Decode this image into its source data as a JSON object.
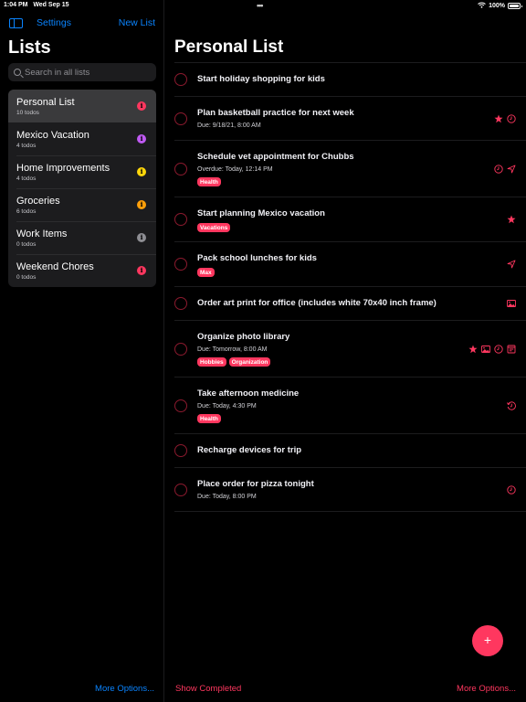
{
  "status_bar": {
    "time": "1:04 PM",
    "date": "Wed Sep 15",
    "multitask_dots": "•••",
    "battery": "100%",
    "battery_level": 1.0
  },
  "sidebar": {
    "settings_label": "Settings",
    "new_list_label": "New List",
    "title": "Lists",
    "search_placeholder": "Search in all lists",
    "lists": [
      {
        "name": "Personal List",
        "count": "10 todos",
        "color": "#ff375f",
        "selected": true
      },
      {
        "name": "Mexico Vacation",
        "count": "4 todos",
        "color": "#bf5af2",
        "selected": false
      },
      {
        "name": "Home Improvements",
        "count": "4 todos",
        "color": "#ffd60a",
        "selected": false
      },
      {
        "name": "Groceries",
        "count": "6 todos",
        "color": "#ff9f0a",
        "selected": false
      },
      {
        "name": "Work Items",
        "count": "0 todos",
        "color": "#8e8e93",
        "selected": false
      },
      {
        "name": "Weekend Chores",
        "count": "0 todos",
        "color": "#ff375f",
        "selected": false
      }
    ],
    "info_glyph": "i",
    "more_options_label": "More Options..."
  },
  "main": {
    "title": "Personal List",
    "accent": "#ff375f",
    "todos": [
      {
        "title": "Start holiday shopping for kids",
        "due": "",
        "tags": [],
        "icons": []
      },
      {
        "title": "Plan basketball practice for next week",
        "due": "Due: 9/18/21, 8:00 AM",
        "tags": [],
        "icons": [
          "star-icon",
          "clock-icon"
        ]
      },
      {
        "title": "Schedule vet appointment for Chubbs",
        "due": "Overdue: Today, 12:14 PM",
        "tags": [
          "Health"
        ],
        "icons": [
          "clock-icon",
          "location-icon"
        ]
      },
      {
        "title": "Start planning Mexico vacation",
        "due": "",
        "tags": [
          "Vacations"
        ],
        "icons": [
          "star-icon"
        ]
      },
      {
        "title": "Pack school lunches for kids",
        "due": "",
        "tags": [
          "Max"
        ],
        "icons": [
          "location-icon"
        ]
      },
      {
        "title": "Order art print for office (includes white 70x40 inch frame)",
        "due": "",
        "tags": [],
        "icons": [
          "photo-icon"
        ]
      },
      {
        "title": "Organize photo library",
        "due": "Due: Tomorrow, 8:00 AM",
        "tags": [
          "Hobbies",
          "Organization"
        ],
        "icons": [
          "star-icon",
          "photo-icon",
          "clock-icon",
          "note-icon"
        ]
      },
      {
        "title": "Take afternoon medicine",
        "due": "Due: Today, 4:30 PM",
        "tags": [
          "Health"
        ],
        "icons": [
          "repeat-clock-icon"
        ]
      },
      {
        "title": "Recharge devices for trip",
        "due": "",
        "tags": [],
        "icons": []
      },
      {
        "title": "Place order for pizza tonight",
        "due": "Due: Today, 8:00 PM",
        "tags": [],
        "icons": [
          "clock-icon"
        ]
      }
    ],
    "add_button_label": "+",
    "show_completed_label": "Show Completed",
    "more_options_label": "More Options..."
  }
}
